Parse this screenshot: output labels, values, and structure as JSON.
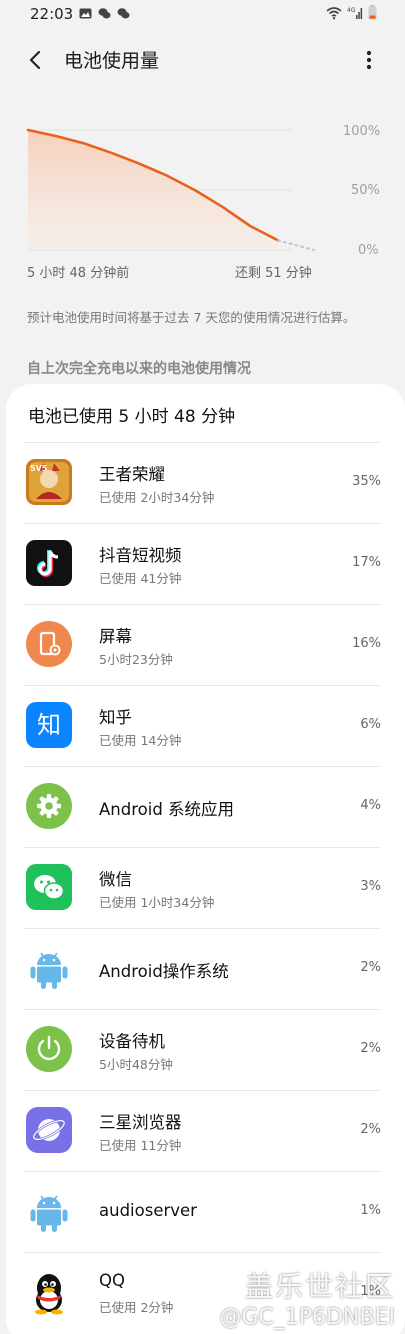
{
  "status_bar": {
    "time": "22:03",
    "left_icons": [
      "image-icon",
      "wechat-icon",
      "wechat-icon"
    ],
    "right_icons": [
      "wifi-icon",
      "signal-4g-icon",
      "battery-low-icon"
    ]
  },
  "header": {
    "title": "电池使用量"
  },
  "chart": {
    "y_labels": [
      "100%",
      "50%",
      "0%"
    ],
    "x_start": "5 小时 48 分钟前",
    "x_end": "还剩 51 分钟"
  },
  "chart_data": {
    "type": "line",
    "title": "",
    "xlabel": "",
    "ylabel": "",
    "ylim": [
      0,
      100
    ],
    "y_ticks": [
      "100%",
      "50%",
      "0%"
    ],
    "x_ticks": [
      "5 小时 48 分钟前",
      "还剩 51 分钟"
    ],
    "series": [
      {
        "values_percent": [
          100,
          95,
          89,
          81,
          72,
          62,
          50,
          36,
          20,
          8
        ]
      }
    ],
    "projection_percent": [
      8,
      0
    ]
  },
  "note": "预计电池使用时间将基于过去 7 天您的使用情况进行估算。",
  "section_title": "自上次完全充电以来的电池使用情况",
  "card": {
    "header": "电池已使用 5 小时 48 分钟",
    "items": [
      {
        "name": "王者荣耀",
        "sub": "已使用 2小时34分钟",
        "pct": "35%",
        "icon": "honor-of-kings-icon"
      },
      {
        "name": "抖音短视频",
        "sub": "已使用 41分钟",
        "pct": "17%",
        "icon": "douyin-icon"
      },
      {
        "name": "屏幕",
        "sub": "5小时23分钟",
        "pct": "16%",
        "icon": "screen-icon"
      },
      {
        "name": "知乎",
        "sub": "已使用 14分钟",
        "pct": "6%",
        "icon": "zhihu-icon"
      },
      {
        "name": "Android 系统应用",
        "sub": "",
        "pct": "4%",
        "icon": "gear-icon"
      },
      {
        "name": "微信",
        "sub": "已使用 1小时34分钟",
        "pct": "3%",
        "icon": "wechat-icon"
      },
      {
        "name": "Android操作系统",
        "sub": "",
        "pct": "2%",
        "icon": "android-icon"
      },
      {
        "name": "设备待机",
        "sub": "5小时48分钟",
        "pct": "2%",
        "icon": "standby-icon"
      },
      {
        "name": "三星浏览器",
        "sub": "已使用 11分钟",
        "pct": "2%",
        "icon": "samsung-browser-icon"
      },
      {
        "name": "audioserver",
        "sub": "",
        "pct": "1%",
        "icon": "android-icon"
      },
      {
        "name": "QQ",
        "sub": "已使用 2分钟",
        "pct": "1%",
        "icon": "qq-icon"
      }
    ]
  },
  "watermark": {
    "line1": "盖乐世社区",
    "line2": "@GC_1P6DNBEI"
  },
  "colors": {
    "accent": "#e8621c",
    "background": "#f2f2f2",
    "card": "#ffffff"
  }
}
